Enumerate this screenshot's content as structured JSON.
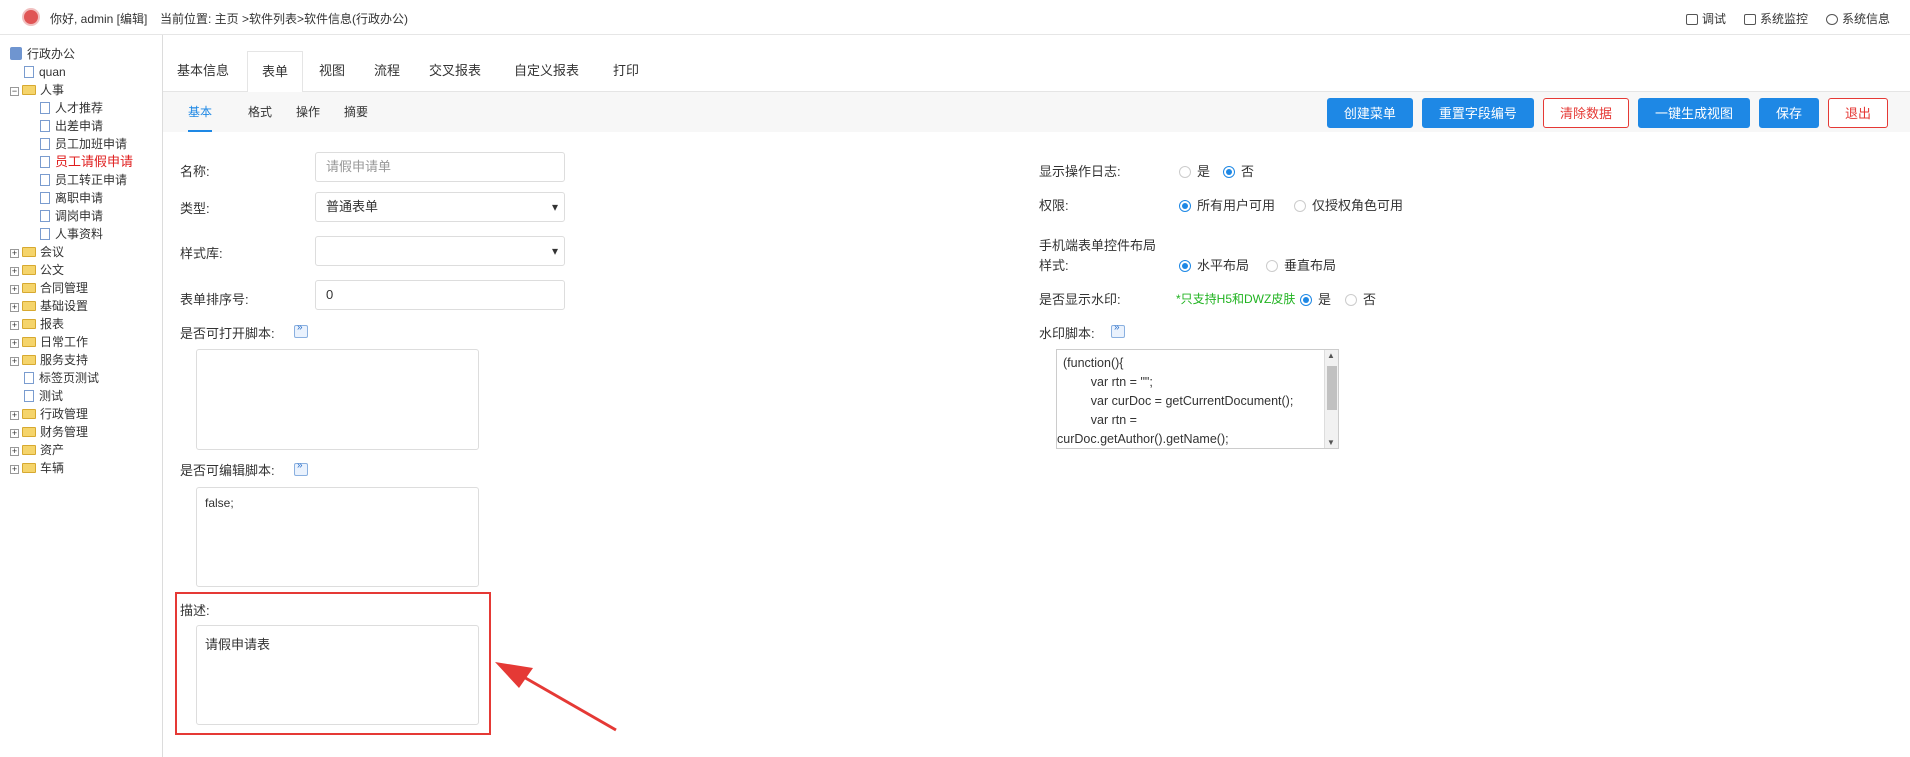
{
  "topbar": {
    "greeting": "你好, admin [编辑]",
    "breadcrumb": "当前位置: 主页 >软件列表>软件信息(行政办公)",
    "tools": [
      "调试",
      "系统监控",
      "系统信息"
    ]
  },
  "sidebar": {
    "root": "行政办公",
    "items": [
      {
        "label": "quan",
        "kind": "doc",
        "level": 1
      },
      {
        "label": "人事",
        "kind": "folder-open",
        "level": 1
      },
      {
        "label": "人才推荐",
        "kind": "doc",
        "level": 2
      },
      {
        "label": "出差申请",
        "kind": "doc",
        "level": 2
      },
      {
        "label": "员工加班申请",
        "kind": "doc",
        "level": 2
      },
      {
        "label": "员工请假申请",
        "kind": "doc",
        "level": 2,
        "active": true
      },
      {
        "label": "员工转正申请",
        "kind": "doc",
        "level": 2
      },
      {
        "label": "离职申请",
        "kind": "doc",
        "level": 2
      },
      {
        "label": "调岗申请",
        "kind": "doc",
        "level": 2
      },
      {
        "label": "人事资料",
        "kind": "doc",
        "level": 2
      },
      {
        "label": "会议",
        "kind": "folder",
        "level": 1
      },
      {
        "label": "公文",
        "kind": "folder",
        "level": 1
      },
      {
        "label": "合同管理",
        "kind": "folder",
        "level": 1
      },
      {
        "label": "基础设置",
        "kind": "folder",
        "level": 1
      },
      {
        "label": "报表",
        "kind": "folder",
        "level": 1
      },
      {
        "label": "日常工作",
        "kind": "folder",
        "level": 1
      },
      {
        "label": "服务支持",
        "kind": "folder",
        "level": 1
      },
      {
        "label": "标签页测试",
        "kind": "doc",
        "level": 1
      },
      {
        "label": "测试",
        "kind": "doc",
        "level": 1
      },
      {
        "label": "行政管理",
        "kind": "folder",
        "level": 1
      },
      {
        "label": "财务管理",
        "kind": "folder",
        "level": 1
      },
      {
        "label": "资产",
        "kind": "folder",
        "level": 1
      },
      {
        "label": "车辆",
        "kind": "folder",
        "level": 1
      }
    ]
  },
  "tabs": [
    "基本信息",
    "表单",
    "视图",
    "流程",
    "交叉报表",
    "自定义报表",
    "打印"
  ],
  "subtabs": [
    "基本",
    "格式",
    "操作",
    "摘要"
  ],
  "buttons": {
    "create_menu": "创建菜单",
    "reset_field_no": "重置字段编号",
    "clear_data": "清除数据",
    "gen_view": "一键生成视图",
    "save": "保存",
    "exit": "退出"
  },
  "form": {
    "name_label": "名称:",
    "name_placeholder": "请假申请单",
    "type_label": "类型:",
    "type_value": "普通表单",
    "style_label": "样式库:",
    "style_value": "",
    "order_label": "表单排序号:",
    "order_value": "0",
    "open_script_label": "是否可打开脚本:",
    "open_script_value": "",
    "edit_script_label": "是否可编辑脚本:",
    "edit_script_value": "false;",
    "desc_label": "描述:",
    "desc_value": "请假申请表"
  },
  "right": {
    "log_label": "显示操作日志:",
    "log_yes": "是",
    "log_no": "否",
    "perm_label": "权限:",
    "perm_all": "所有用户可用",
    "perm_role": "仅授权角色可用",
    "mobile_label_1": "手机端表单控件布局",
    "mobile_label_2": "样式:",
    "mobile_h": "水平布局",
    "mobile_v": "垂直布局",
    "wm_label": "是否显示水印:",
    "wm_note": "*只支持H5和DWZ皮肤",
    "wm_yes": "是",
    "wm_no": "否",
    "wm_script_label": "水印脚本:",
    "wm_script_lines": [
      "(function(){",
      "        var rtn = \"\";",
      "        var curDoc = getCurrentDocument();",
      "        var rtn =",
      "curDoc.getAuthor().getName();"
    ]
  },
  "colors": {
    "primary": "#1e88e5",
    "danger": "#e53935",
    "note": "#21b321",
    "active_tree": "#e02020"
  }
}
